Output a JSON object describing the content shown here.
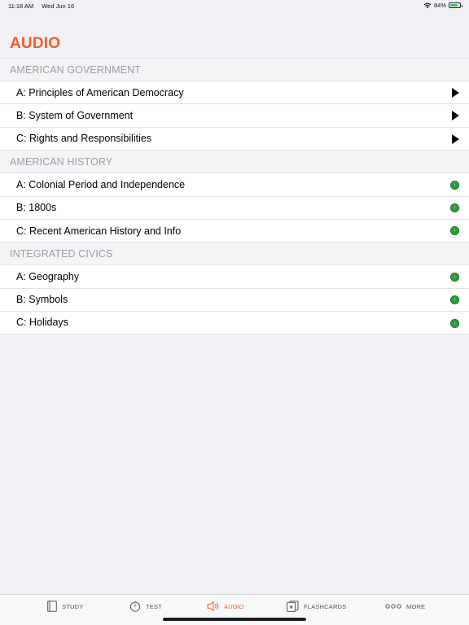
{
  "status_bar": {
    "time": "11:18 AM",
    "date": "Wed Jun 16",
    "battery_percent": "84%",
    "battery_level": 0.84,
    "wifi_icon": "wifi-icon",
    "battery_icon": "battery-icon"
  },
  "page": {
    "title": "AUDIO"
  },
  "sections": [
    {
      "header": "AMERICAN GOVERNMENT",
      "items": [
        {
          "label": "A: Principles of American Democracy",
          "indicator": "play-icon"
        },
        {
          "label": "B: System of Government",
          "indicator": "play-icon"
        },
        {
          "label": "C: Rights and Responsibilities",
          "indicator": "play-icon"
        }
      ]
    },
    {
      "header": "AMERICAN HISTORY",
      "items": [
        {
          "label": "A: Colonial Period and Independence",
          "indicator": "green-status-icon"
        },
        {
          "label": "B: 1800s",
          "indicator": "green-status-icon"
        },
        {
          "label": "C: Recent American History and Info",
          "indicator": "green-status-icon"
        }
      ]
    },
    {
      "header": "INTEGRATED CIVICS",
      "items": [
        {
          "label": "A: Geography",
          "indicator": "green-status-icon"
        },
        {
          "label": "B: Symbols",
          "indicator": "green-status-icon"
        },
        {
          "label": "C: Holidays",
          "indicator": "green-status-icon"
        }
      ]
    }
  ],
  "tab_bar": {
    "tabs": [
      {
        "label": "STUDY",
        "icon": "book-icon",
        "active": false
      },
      {
        "label": "TEST",
        "icon": "stopwatch-icon",
        "active": false
      },
      {
        "label": "AUDIO",
        "icon": "speaker-icon",
        "active": true
      },
      {
        "label": "FLASHCARDS",
        "icon": "flashcards-icon",
        "active": false
      },
      {
        "label": "MORE",
        "icon": "more-icon",
        "active": false
      }
    ]
  },
  "colors": {
    "accent": "#ef5c2a",
    "status_green": "#2d9a3c",
    "section_header_text": "#9d9da2",
    "background": "#f1f1f5"
  }
}
